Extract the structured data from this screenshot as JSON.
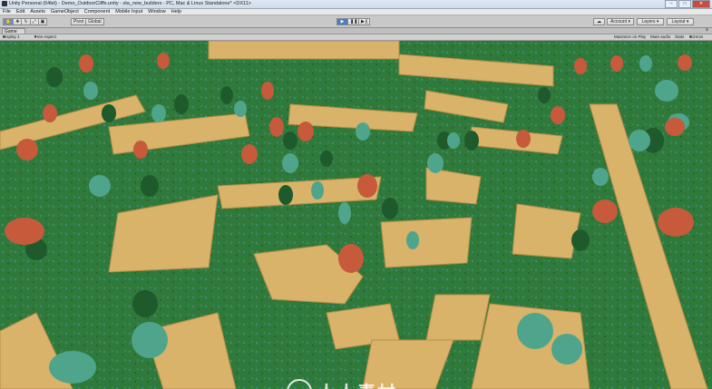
{
  "window": {
    "title": "Unity Personal (64bit) - Demo_OutdoorCliffs.unity - sta_new_builders - PC, Mac & Linux Standalone* <DX11>",
    "controls": [
      "–",
      "□",
      "✕"
    ]
  },
  "menu": [
    "File",
    "Edit",
    "Assets",
    "GameObject",
    "Component",
    "Mobile Input",
    "Window",
    "Help"
  ],
  "toolbar": {
    "pivot_label": "Pivot",
    "global_label": "Global",
    "play_icon": "play-icon",
    "pause_icon": "pause-icon",
    "step_icon": "step-icon",
    "account_label": "Account",
    "layers_label": "Layers",
    "layout_label": "Layout"
  },
  "game_view": {
    "tab_label": "Game",
    "display_label": "Display 1",
    "aspect_label": "Free Aspect",
    "maximize_label": "Maximize on Play",
    "mute_label": "Mute audio",
    "stats_label": "Stats",
    "gizmos_label": "Gizmos"
  },
  "colors": {
    "ground": "#2f7a3b",
    "cliff": "#e0bb72",
    "tree_dark": "#1f5a2c",
    "tree_teal": "#4fa58c",
    "tree_orange": "#c65a3a",
    "play_active": "#4a7cc8"
  },
  "watermark": {
    "text": "人人素材"
  }
}
